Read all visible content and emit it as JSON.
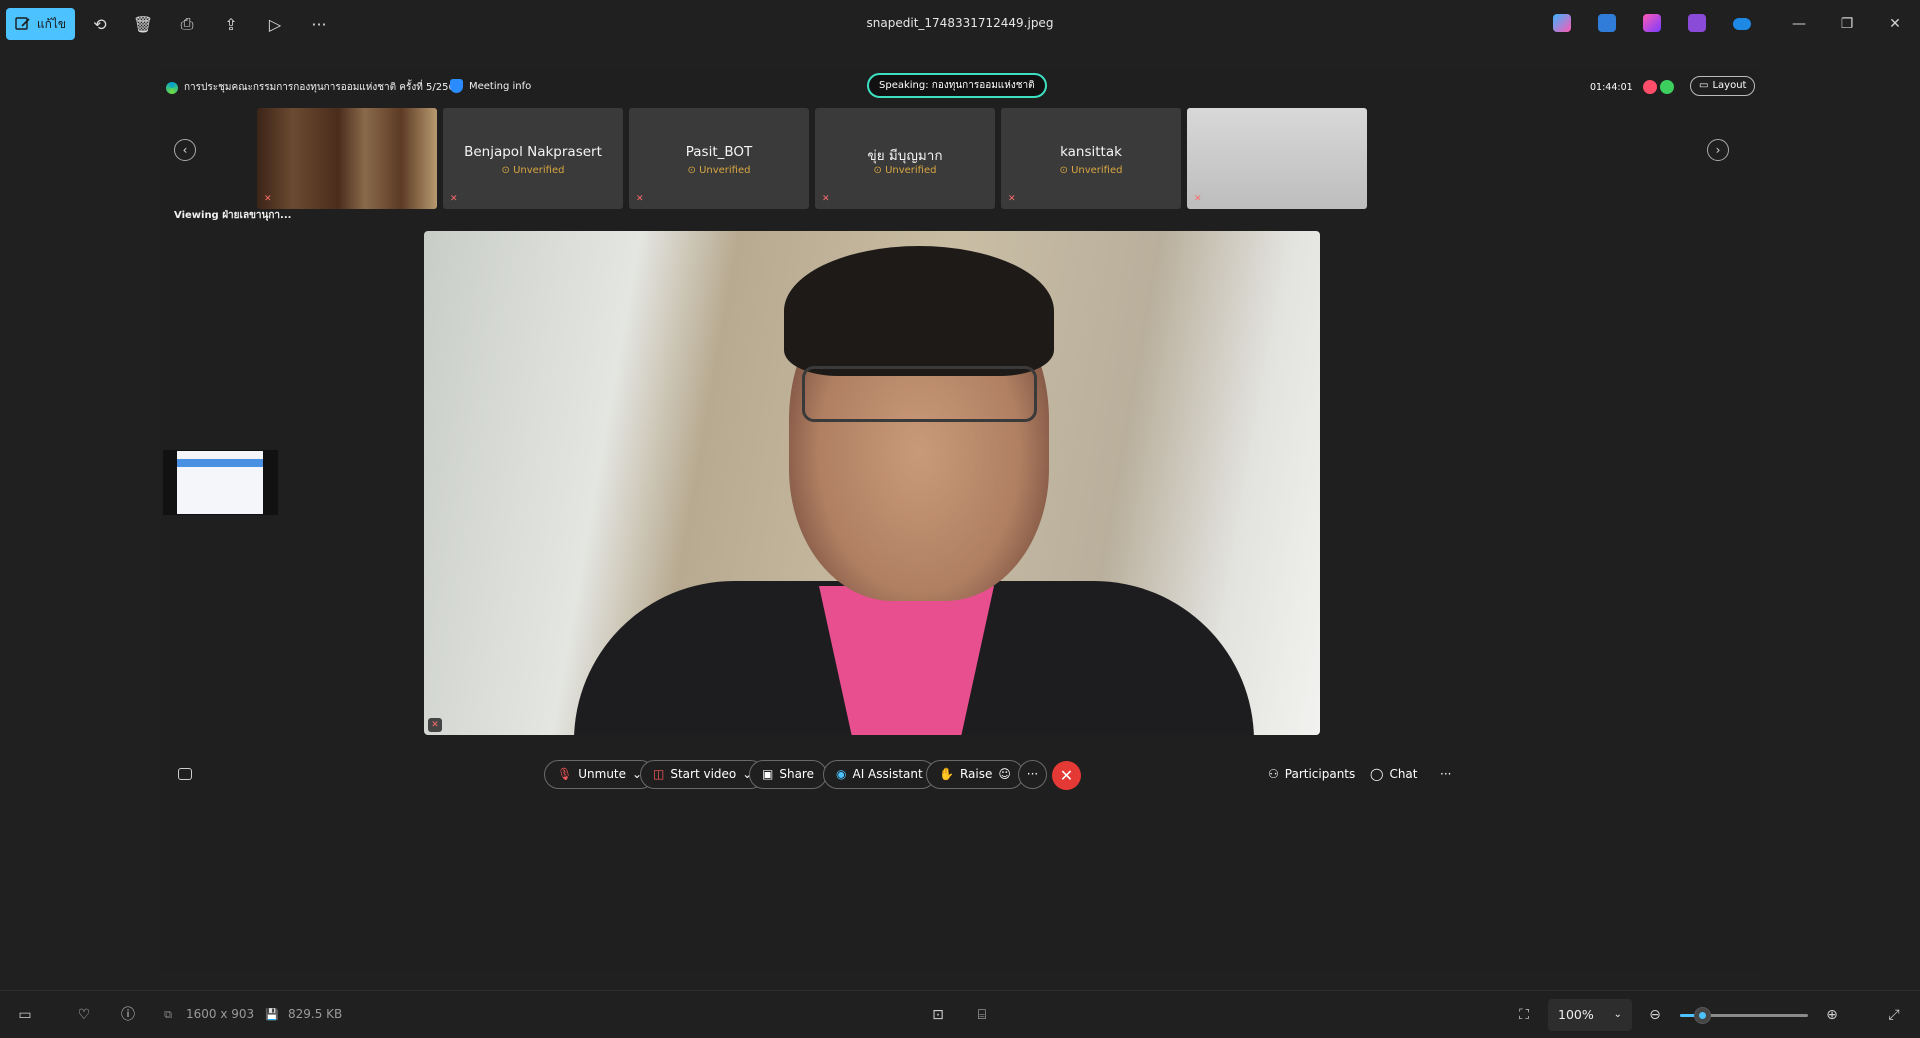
{
  "toolbar": {
    "edit_label": "แก้ไข",
    "file_name": "snapedit_1748331712449.jpeg",
    "more_icon": "more-icon"
  },
  "meeting": {
    "title": "การประชุมคณะกรรมการกองทุนการออมแห่งชาติ ครั้งที่ 5/2568",
    "meeting_info": "Meeting info",
    "speaking": "Speaking: กองทุนการออมแห่งชาติ",
    "timer": "01:44:01",
    "layout_label": "Layout",
    "participants": [
      {
        "name": "",
        "video": true
      },
      {
        "name": "Benjapol Nakprasert",
        "badge": "Unverified"
      },
      {
        "name": "Pasit_BOT",
        "badge": "Unverified"
      },
      {
        "name": "ขุ่ย  มีบุญมาก",
        "badge": "Unverified"
      },
      {
        "name": "kansittak",
        "badge": "Unverified"
      },
      {
        "name": "",
        "video": true
      }
    ],
    "viewing": "Viewing ฝ่ายเลขานุกา...",
    "controls": {
      "unmute": "Unmute",
      "start_video": "Start video",
      "share": "Share",
      "ai_assistant": "AI Assistant",
      "raise": "Raise",
      "participants": "Participants",
      "chat": "Chat"
    },
    "status_colors": {
      "recording": "#ff4d6a",
      "connected": "#3ccf5e",
      "speaking_border": "#3ce0c0",
      "leave": "#e53935"
    }
  },
  "statusbar": {
    "dimensions": "1600 x 903",
    "file_size": "829.5 KB",
    "zoom": "100%",
    "zoom_level": 0.17
  }
}
